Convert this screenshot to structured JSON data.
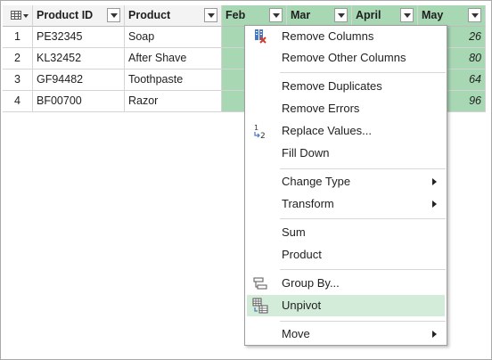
{
  "table": {
    "columns": [
      {
        "label": "Product ID"
      },
      {
        "label": "Product"
      },
      {
        "label": "Feb"
      },
      {
        "label": "Mar"
      },
      {
        "label": "April"
      },
      {
        "label": "May"
      }
    ],
    "rows": [
      {
        "num": "1",
        "id": "PE32345",
        "product": "Soap",
        "may": "26"
      },
      {
        "num": "2",
        "id": "KL32452",
        "product": "After Shave",
        "may": "80"
      },
      {
        "num": "3",
        "id": "GF94482",
        "product": "Toothpaste",
        "may": "64"
      },
      {
        "num": "4",
        "id": "BF00700",
        "product": "Razor",
        "may": "96"
      }
    ]
  },
  "menu": {
    "items": {
      "remove_columns": "Remove Columns",
      "remove_other_columns": "Remove Other Columns",
      "remove_duplicates": "Remove Duplicates",
      "remove_errors": "Remove Errors",
      "replace_values": "Replace Values...",
      "fill_down": "Fill Down",
      "change_type": "Change Type",
      "transform": "Transform",
      "sum": "Sum",
      "product": "Product",
      "group_by": "Group By...",
      "unpivot": "Unpivot",
      "move": "Move"
    },
    "replace_icon_text": {
      "top": "1",
      "bottom": "2"
    }
  },
  "colors": {
    "selected_column": "#a8d7b4",
    "menu_hover": "#d3ecd9"
  },
  "icons": [
    "table-icon",
    "dropdown-arrow-icon",
    "remove-columns-icon",
    "replace-values-icon",
    "group-by-icon",
    "unpivot-icon",
    "submenu-arrow-icon"
  ]
}
